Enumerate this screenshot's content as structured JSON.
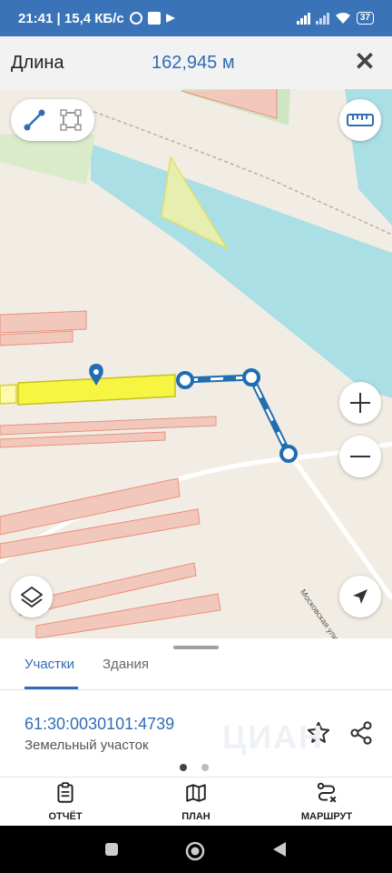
{
  "status_bar": {
    "time_speed": "21:41 | 15,4 КБ/с",
    "battery": "37"
  },
  "header": {
    "title": "Длина",
    "length": "162,945 м",
    "close_icon": "close-icon"
  },
  "map": {
    "street_label": "Московская улица",
    "controls": {
      "line_mode_icon": "line-measure-icon",
      "area_mode_icon": "polygon-measure-icon",
      "ruler_icon": "ruler-icon",
      "zoom_in_icon": "plus-icon",
      "zoom_out_icon": "minus-icon",
      "layers_icon": "layers-icon",
      "locate_icon": "navigation-arrow-icon"
    },
    "colors": {
      "water": "#aadfe6",
      "parcel_fill": "#f3c8bc",
      "parcel_stroke": "#e8907a",
      "selected_parcel": "#f5f542",
      "green": "#cfe6c4",
      "measure_line": "#1f6db3"
    }
  },
  "sheet": {
    "tabs": [
      {
        "label": "Участки",
        "active": true
      },
      {
        "label": "Здания",
        "active": false
      }
    ],
    "parcel_id": "61:30:0030101:4739",
    "parcel_type": "Земельный участок",
    "watermark": "ЦИАН",
    "pages": 2,
    "current_page": 1
  },
  "bottom_nav": [
    {
      "label": "ОТЧЁТ",
      "icon": "report-icon"
    },
    {
      "label": "ПЛАН",
      "icon": "map-icon"
    },
    {
      "label": "МАРШРУТ",
      "icon": "route-icon"
    }
  ]
}
